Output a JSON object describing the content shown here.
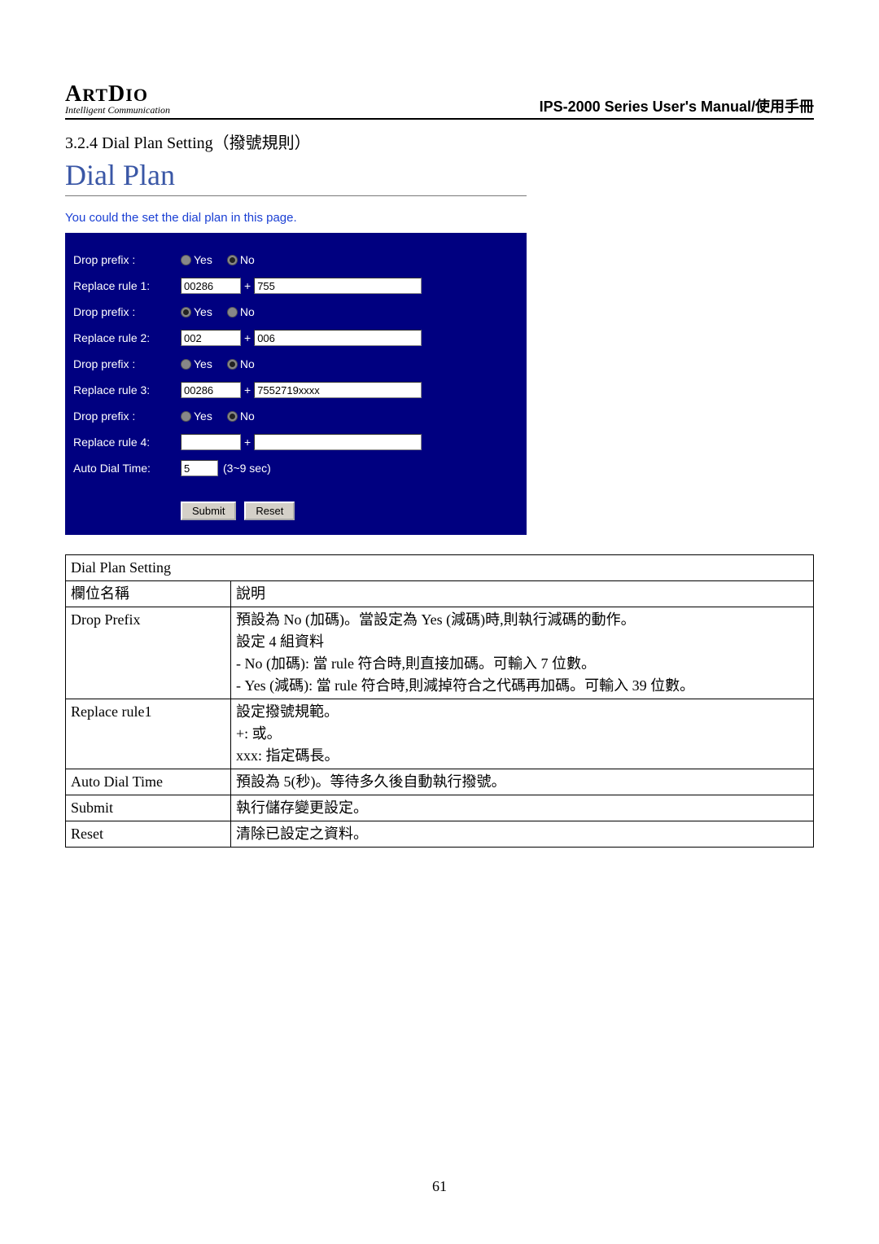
{
  "logo": {
    "brand": "ArtDio",
    "sub": "Intelligent Communication"
  },
  "manual_title": "IPS-2000 Series User's Manual/使用手冊",
  "section_title": "3.2.4 Dial Plan Setting（撥號規則）",
  "panel": {
    "title": "Dial Plan",
    "note": "You could the set the dial plan in this page.",
    "rows": {
      "drop1": {
        "label": "Drop prefix :",
        "yes": "Yes",
        "no": "No",
        "selected": "no"
      },
      "rule1": {
        "label": "Replace rule 1:",
        "left": "00286",
        "right": "755"
      },
      "drop2": {
        "label": "Drop prefix :",
        "yes": "Yes",
        "no": "No",
        "selected": "yes"
      },
      "rule2": {
        "label": "Replace rule 2:",
        "left": "002",
        "right": "006"
      },
      "drop3": {
        "label": "Drop prefix :",
        "yes": "Yes",
        "no": "No",
        "selected": "no"
      },
      "rule3": {
        "label": "Replace rule 3:",
        "left": "00286",
        "right": "7552719xxxx"
      },
      "drop4": {
        "label": "Drop prefix :",
        "yes": "Yes",
        "no": "No",
        "selected": "no"
      },
      "rule4": {
        "label": "Replace rule 4:",
        "left": "",
        "right": ""
      },
      "auto": {
        "label": "Auto Dial Time:",
        "value": "5",
        "hint": "(3~9 sec)"
      }
    },
    "buttons": {
      "submit": "Submit",
      "reset": "Reset"
    },
    "plus": "+"
  },
  "table": {
    "caption": "Dial Plan Setting",
    "head_field": "欄位名稱",
    "head_desc": "說明",
    "rows": [
      {
        "field": "Drop Prefix",
        "desc": "預設為 No (加碼)。當設定為 Yes (減碼)時,則執行減碼的動作。\n設定 4 組資料\n- No (加碼):  當 rule 符合時,則直接加碼。可輸入 7 位數。\n- Yes (減碼):  當 rule 符合時,則減掉符合之代碼再加碼。可輸入 39 位數。"
      },
      {
        "field": "Replace rule1",
        "desc": "設定撥號規範。\n+:  或。\nxxx:  指定碼長。"
      },
      {
        "field": "Auto Dial Time",
        "desc": "預設為 5(秒)。等待多久後自動執行撥號。"
      },
      {
        "field": "Submit",
        "desc": "執行儲存變更設定。"
      },
      {
        "field": "Reset",
        "desc": "清除已設定之資料。"
      }
    ]
  },
  "page_number": "61"
}
